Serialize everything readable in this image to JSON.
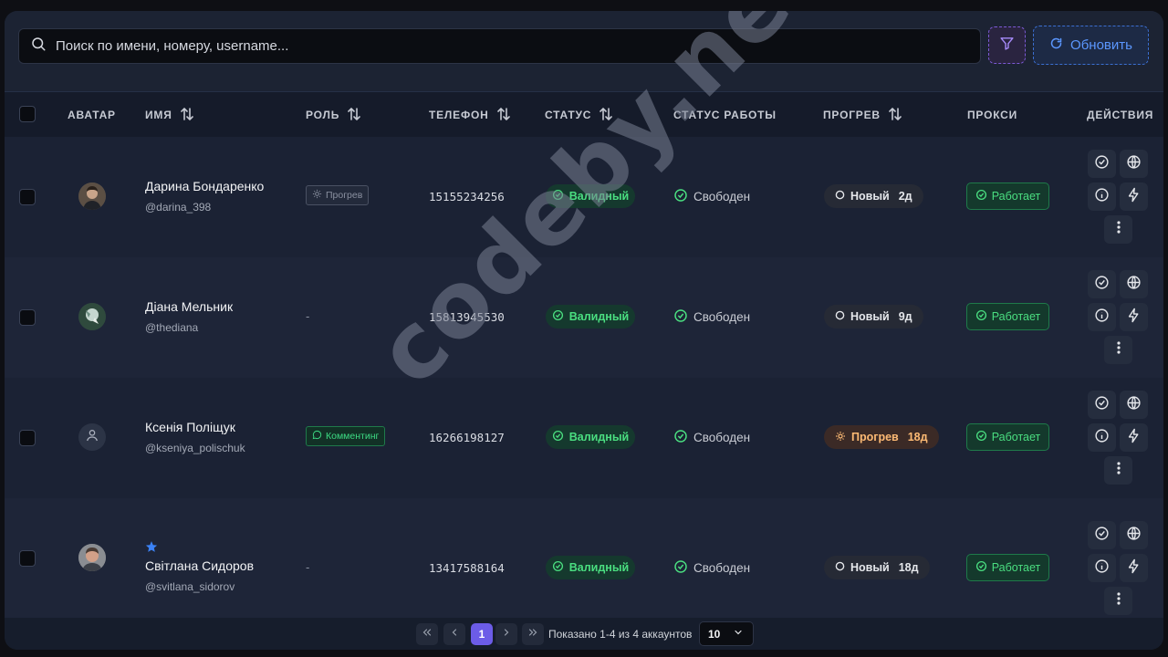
{
  "search": {
    "placeholder": "Поиск по имени, номеру, username..."
  },
  "toolbar": {
    "refresh_label": "Обновить"
  },
  "columns": {
    "avatar": "АВАТАР",
    "name": "ИМЯ",
    "role": "РОЛЬ",
    "phone": "ТЕЛЕФОН",
    "status": "СТАТУС",
    "work_status": "СТАТУС РАБОТЫ",
    "warmup": "ПРОГРЕВ",
    "proxy": "ПРОКСИ",
    "actions": "ДЕЙСТВИЯ"
  },
  "rows": [
    {
      "name": "Дарина Бондаренко",
      "username": "@darina_398",
      "role": "Прогрев",
      "phone": "15155234256",
      "status": "Валидный",
      "work_status": "Свободен",
      "warmup": "Новый",
      "warmup_days": "2д",
      "proxy": "Работает"
    },
    {
      "name": "Діана Мельник",
      "username": "@thediana",
      "role": "-",
      "phone": "15813945530",
      "status": "Валидный",
      "work_status": "Свободен",
      "warmup": "Новый",
      "warmup_days": "9д",
      "proxy": "Работает"
    },
    {
      "name": "Ксенія Поліщук",
      "username": "@kseniya_polischuk",
      "role": "Комментинг",
      "phone": "16266198127",
      "status": "Валидный",
      "work_status": "Свободен",
      "warmup": "Прогрев",
      "warmup_days": "18д",
      "proxy": "Работает"
    },
    {
      "name": "Світлана Сидоров",
      "username": "@svitlana_sidorov",
      "role": "-",
      "phone": "13417588164",
      "status": "Валидный",
      "work_status": "Свободен",
      "warmup": "Новый",
      "warmup_days": "18д",
      "proxy": "Работает"
    }
  ],
  "pagination": {
    "current_page": "1",
    "info": "Показано 1-4 из 4 аккаунтов",
    "per_page": "10"
  },
  "watermark": "codeby.net",
  "colors": {
    "accent_purple": "#6c5ce7",
    "accent_blue": "#5b97ff",
    "success_green": "#4ade80",
    "warm_orange": "#fdba74"
  }
}
